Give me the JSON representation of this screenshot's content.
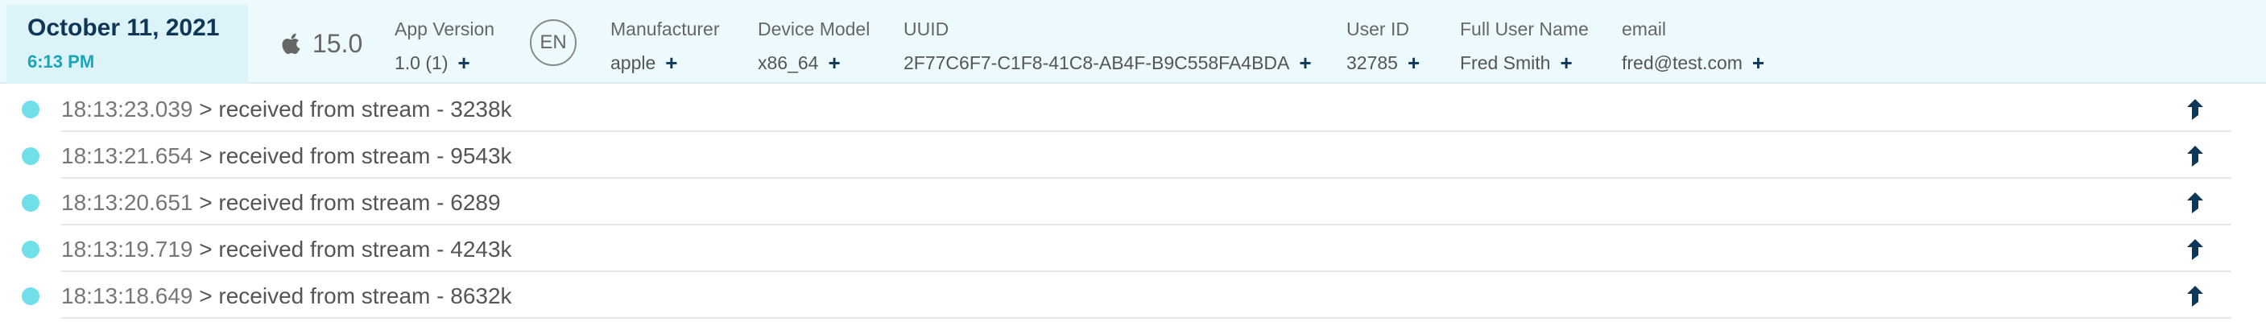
{
  "header": {
    "date": "October 11, 2021",
    "time": "6:13 PM",
    "os_icon": "apple-icon",
    "os_version": "15.0",
    "language": "EN",
    "fields": [
      {
        "label": "App Version",
        "value": "1.0 (1)",
        "plus": "+"
      },
      {
        "label": "Manufacturer",
        "value": "apple",
        "plus": "+"
      },
      {
        "label": "Device Model",
        "value": "x86_64",
        "plus": "+"
      },
      {
        "label": "UUID",
        "value": "2F77C6F7-C1F8-41C8-AB4F-B9C558FA4BDA",
        "plus": "+"
      },
      {
        "label": "User ID",
        "value": "32785",
        "plus": "+"
      },
      {
        "label": "Full User Name",
        "value": "Fred Smith",
        "plus": "+"
      },
      {
        "label": "email",
        "value": "fred@test.com",
        "plus": "+"
      }
    ]
  },
  "logs": [
    {
      "time": "18:13:23.039",
      "message": "> received from stream - 3238k",
      "icon": "upload-arrow-icon"
    },
    {
      "time": "18:13:21.654",
      "message": "> received from stream - 9543k",
      "icon": "upload-arrow-icon"
    },
    {
      "time": "18:13:20.651",
      "message": "> received from stream - 6289",
      "icon": "upload-arrow-icon"
    },
    {
      "time": "18:13:19.719",
      "message": "> received from stream - 4243k",
      "icon": "upload-arrow-icon"
    },
    {
      "time": "18:13:18.649",
      "message": "> received from stream - 8632k",
      "icon": "upload-arrow-icon"
    }
  ],
  "colors": {
    "header_bg": "#edfafd",
    "date_bg": "#dcf3fa",
    "date_text": "#0d3657",
    "time_text": "#1aa6b8",
    "dot": "#6fe0ea",
    "accent": "#0d3657"
  }
}
